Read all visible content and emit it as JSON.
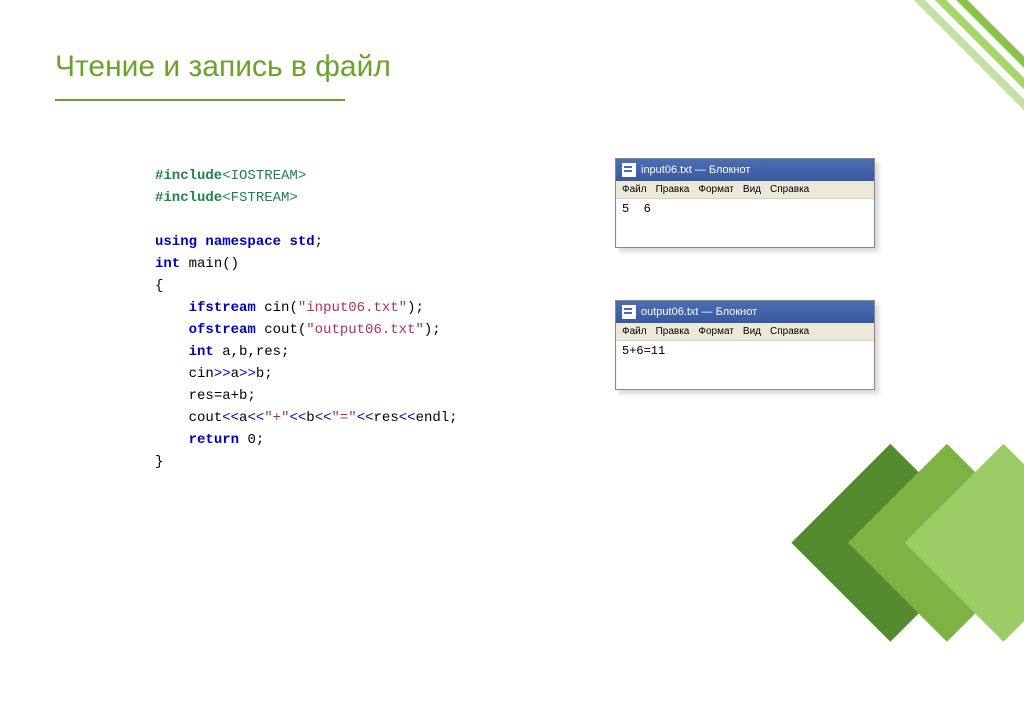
{
  "slide": {
    "title": "Чтение и запись в файл"
  },
  "code": {
    "inc1_pre": "#include",
    "inc1_hdr": "<IOSTREAM>",
    "inc2_pre": "#include",
    "inc2_hdr": "<FSTREAM>",
    "using_kw": "using",
    "ns_kw": "namespace",
    "std_id": "std",
    "int_kw": "int",
    "main_id": "main",
    "ifstream_kw": "ifstream",
    "cin_id": "cin",
    "str_input": "\"input06.txt\"",
    "ofstream_kw": "ofstream",
    "cout_id": "cout",
    "str_output": "\"output06.txt\"",
    "int_kw2": "int",
    "vars": "a,b,res;",
    "cin2": "cin",
    "shr1": ">>",
    "a": "a",
    "shr2": ">>",
    "b": "b",
    "res_assign": "res=a+b;",
    "cout2": "cout",
    "shl1": "<<",
    "a2": "a",
    "shl2": "<<",
    "plusstr": "\"+\"",
    "shl3": "<<",
    "b2": "b",
    "shl4": "<<",
    "eqstr": "\"=\"",
    "shl5": "<<",
    "res2": "res",
    "shl6": "<<",
    "endl": "endl",
    "return_kw": "return",
    "zero": "0"
  },
  "notepad1": {
    "title": "input06.txt — Блокнот",
    "menu": {
      "file": "Файл",
      "edit": "Правка",
      "format": "Формат",
      "view": "Вид",
      "help": "Справка"
    },
    "content": "5  6"
  },
  "notepad2": {
    "title": "output06.txt — Блокнот",
    "menu": {
      "file": "Файл",
      "edit": "Правка",
      "format": "Формат",
      "view": "Вид",
      "help": "Справка"
    },
    "content": "5+6=11"
  }
}
